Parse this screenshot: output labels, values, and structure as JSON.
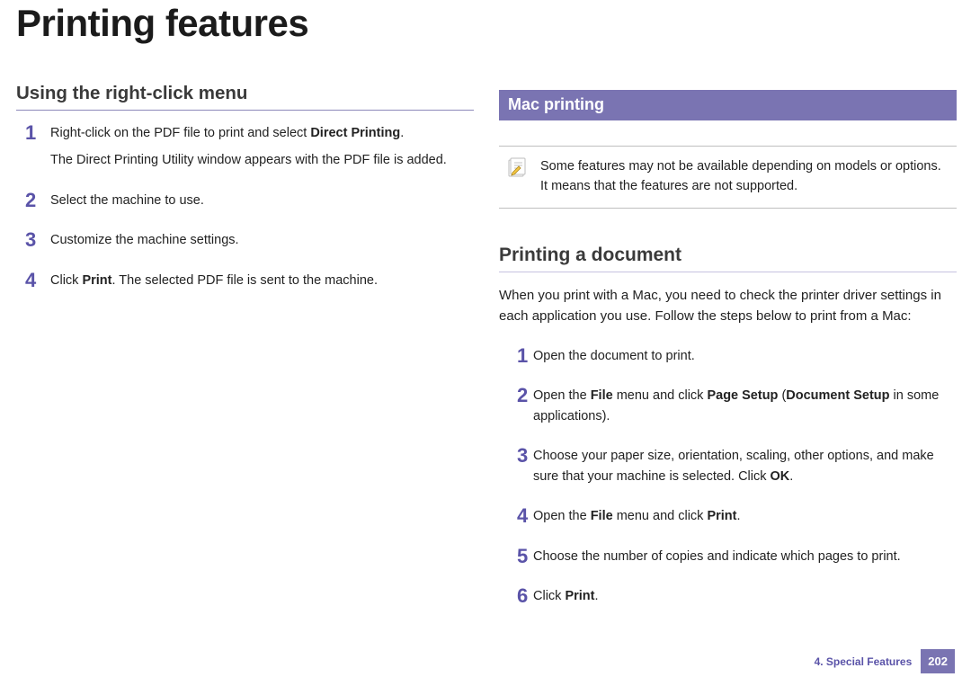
{
  "title": "Printing features",
  "left": {
    "heading": "Using the right-click menu",
    "steps": [
      {
        "num": "1",
        "paras": [
          [
            {
              "t": "Right-click on the PDF file to print and select "
            },
            {
              "t": "Direct Printing",
              "b": true
            },
            {
              "t": "."
            }
          ],
          [
            {
              "t": "The Direct Printing Utility window appears with the PDF file is added."
            }
          ]
        ]
      },
      {
        "num": "2",
        "paras": [
          [
            {
              "t": "Select the machine to use."
            }
          ]
        ]
      },
      {
        "num": "3",
        "paras": [
          [
            {
              "t": "Customize the machine settings."
            }
          ]
        ]
      },
      {
        "num": "4",
        "paras": [
          [
            {
              "t": "Click "
            },
            {
              "t": "Print",
              "b": true
            },
            {
              "t": ". The selected PDF file is sent to the machine."
            }
          ]
        ]
      }
    ]
  },
  "right": {
    "bar": "Mac printing",
    "note": "Some features may not be available depending on models or options. It means that the features are not supported.",
    "sub_heading": "Printing a document",
    "intro": "When you print with a Mac, you need to check the printer driver settings in each application you use. Follow the steps below to print from a Mac:",
    "steps": [
      {
        "num": "1",
        "paras": [
          [
            {
              "t": "Open the document to print."
            }
          ]
        ]
      },
      {
        "num": "2",
        "paras": [
          [
            {
              "t": "Open the "
            },
            {
              "t": "File",
              "b": true
            },
            {
              "t": " menu and click "
            },
            {
              "t": "Page Setup",
              "b": true
            },
            {
              "t": " ("
            },
            {
              "t": "Document Setup",
              "b": true
            },
            {
              "t": " in some applications)."
            }
          ]
        ]
      },
      {
        "num": "3",
        "paras": [
          [
            {
              "t": "Choose your paper size, orientation, scaling, other options, and make sure that your machine is selected. Click "
            },
            {
              "t": "OK",
              "b": true
            },
            {
              "t": "."
            }
          ]
        ]
      },
      {
        "num": "4",
        "paras": [
          [
            {
              "t": "Open the "
            },
            {
              "t": "File",
              "b": true
            },
            {
              "t": " menu and click "
            },
            {
              "t": "Print",
              "b": true
            },
            {
              "t": "."
            }
          ]
        ]
      },
      {
        "num": "5",
        "paras": [
          [
            {
              "t": "Choose the number of copies and indicate which pages to print."
            }
          ]
        ]
      },
      {
        "num": "6",
        "paras": [
          [
            {
              "t": "Click "
            },
            {
              "t": "Print",
              "b": true
            },
            {
              "t": "."
            }
          ]
        ]
      }
    ]
  },
  "footer": {
    "chapter": "4.  Special Features",
    "page": "202"
  }
}
